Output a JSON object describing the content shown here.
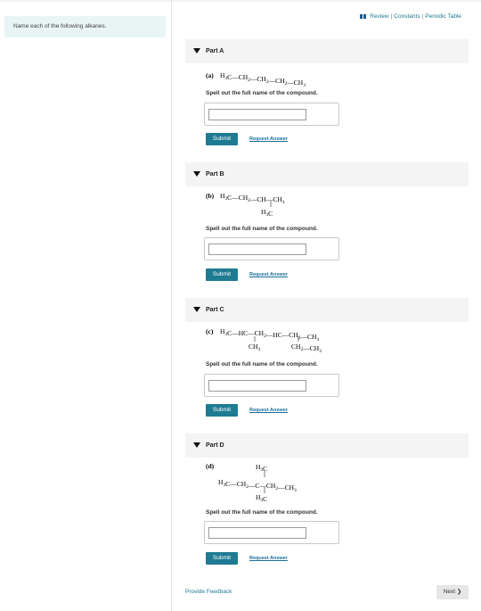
{
  "intro": "Name each of the following alkanes.",
  "top_links": {
    "review": "Review",
    "constants": "Constants",
    "periodic_table": "Periodic Table"
  },
  "parts": [
    {
      "title": "Part A",
      "label": "(a)",
      "formula": {
        "main": "H3C—CH2—CH2—CH2—CH3"
      },
      "prompt": "Spell out the full name of the compound.",
      "input_value": "",
      "submit": "Submit",
      "request": "Request Answer"
    },
    {
      "title": "Part B",
      "label": "(b)",
      "formula": {
        "main": "H3C—CH2—CH—CH3",
        "sub": "H3C"
      },
      "prompt": "Spell out the full name of the compound.",
      "input_value": "",
      "submit": "Submit",
      "request": "Request Answer"
    },
    {
      "title": "Part C",
      "label": "(c)",
      "formula": {
        "main": "H3C—HC—CH2—HC—CH2—CH3",
        "sub_left": "CH3",
        "sub_right": "CH2—CH3"
      },
      "prompt": "Spell out the full name of the compound.",
      "input_value": "",
      "submit": "Submit",
      "request": "Request Answer"
    },
    {
      "title": "Part D",
      "label": "(d)",
      "formula": {
        "top": "H3C",
        "main": "H3C—CH2—C—CH2—CH3",
        "bottom": "H3C"
      },
      "prompt": "Spell out the full name of the compound.",
      "input_value": "",
      "submit": "Submit",
      "request": "Request Answer"
    }
  ],
  "feedback": "Provide Feedback",
  "next": "Next"
}
